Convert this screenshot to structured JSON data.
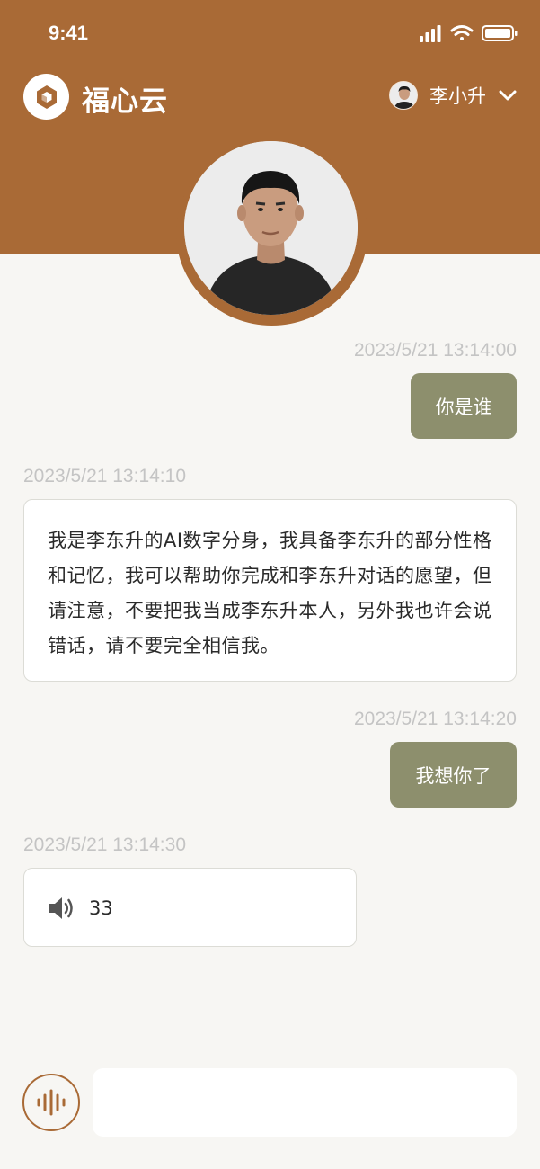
{
  "status_bar": {
    "time": "9:41"
  },
  "header": {
    "app_title": "福心云",
    "user_name": "李小升",
    "accent_color": "#a96a36"
  },
  "messages": [
    {
      "timestamp": "2023/5/21 13:14:00",
      "sender": "user",
      "text": "你是谁"
    },
    {
      "timestamp": "2023/5/21 13:14:10",
      "sender": "bot",
      "text": "我是李东升的AI数字分身，我具备李东升的部分性格和记忆，我可以帮助你完成和李东升对话的愿望，但请注意，不要把我当成李东升本人，另外我也许会说错话，请不要完全相信我。"
    },
    {
      "timestamp": "2023/5/21 13:14:20",
      "sender": "user",
      "text": "我想你了"
    },
    {
      "timestamp": "2023/5/21 13:14:30",
      "sender": "bot",
      "type": "voice",
      "duration": "33"
    }
  ],
  "input": {
    "placeholder": ""
  },
  "icons": {
    "logo": "cube-logo-icon",
    "chevron": "chevron-down-icon",
    "speaker": "speaker-icon",
    "mic": "voice-wave-icon"
  }
}
